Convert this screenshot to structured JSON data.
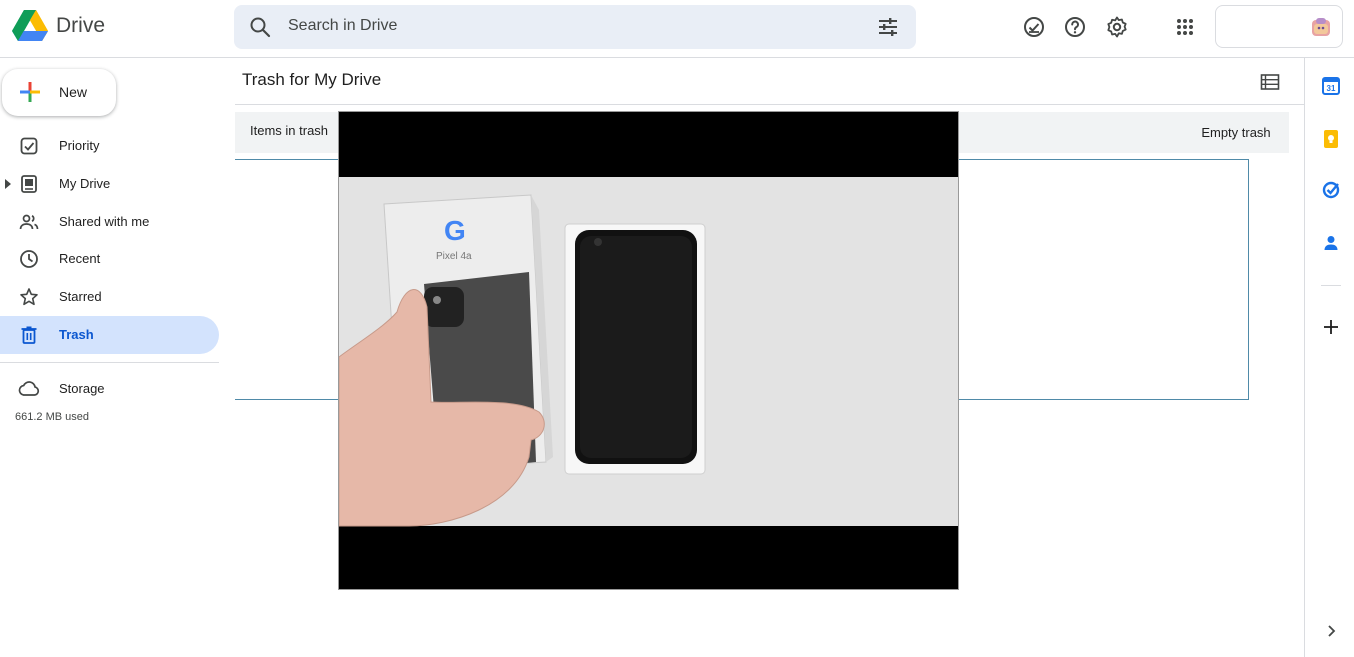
{
  "app": {
    "name": "Drive"
  },
  "search": {
    "placeholder": "Search in Drive"
  },
  "sidebar": {
    "new_label": "New",
    "items": [
      {
        "label": "Priority",
        "icon": "priority-icon"
      },
      {
        "label": "My Drive",
        "icon": "my-drive-icon"
      },
      {
        "label": "Shared with me",
        "icon": "shared-icon"
      },
      {
        "label": "Recent",
        "icon": "clock-icon"
      },
      {
        "label": "Starred",
        "icon": "star-icon"
      },
      {
        "label": "Trash",
        "icon": "trash-icon",
        "active": true
      },
      {
        "label": "Storage",
        "icon": "cloud-icon"
      }
    ],
    "storage_used": "661.2 MB used"
  },
  "main": {
    "title": "Trash for My Drive",
    "info_text": "Items in trash",
    "empty_trash_label": "Empty trash"
  },
  "video_overlay": {
    "box_logo": "G",
    "box_text": "Pixel 4a"
  },
  "colors": {
    "accent": "#0b57d0",
    "active_bg": "#d3e3fd",
    "search_bg": "#e9eef6",
    "info_bar_bg": "#f1f3f4"
  }
}
